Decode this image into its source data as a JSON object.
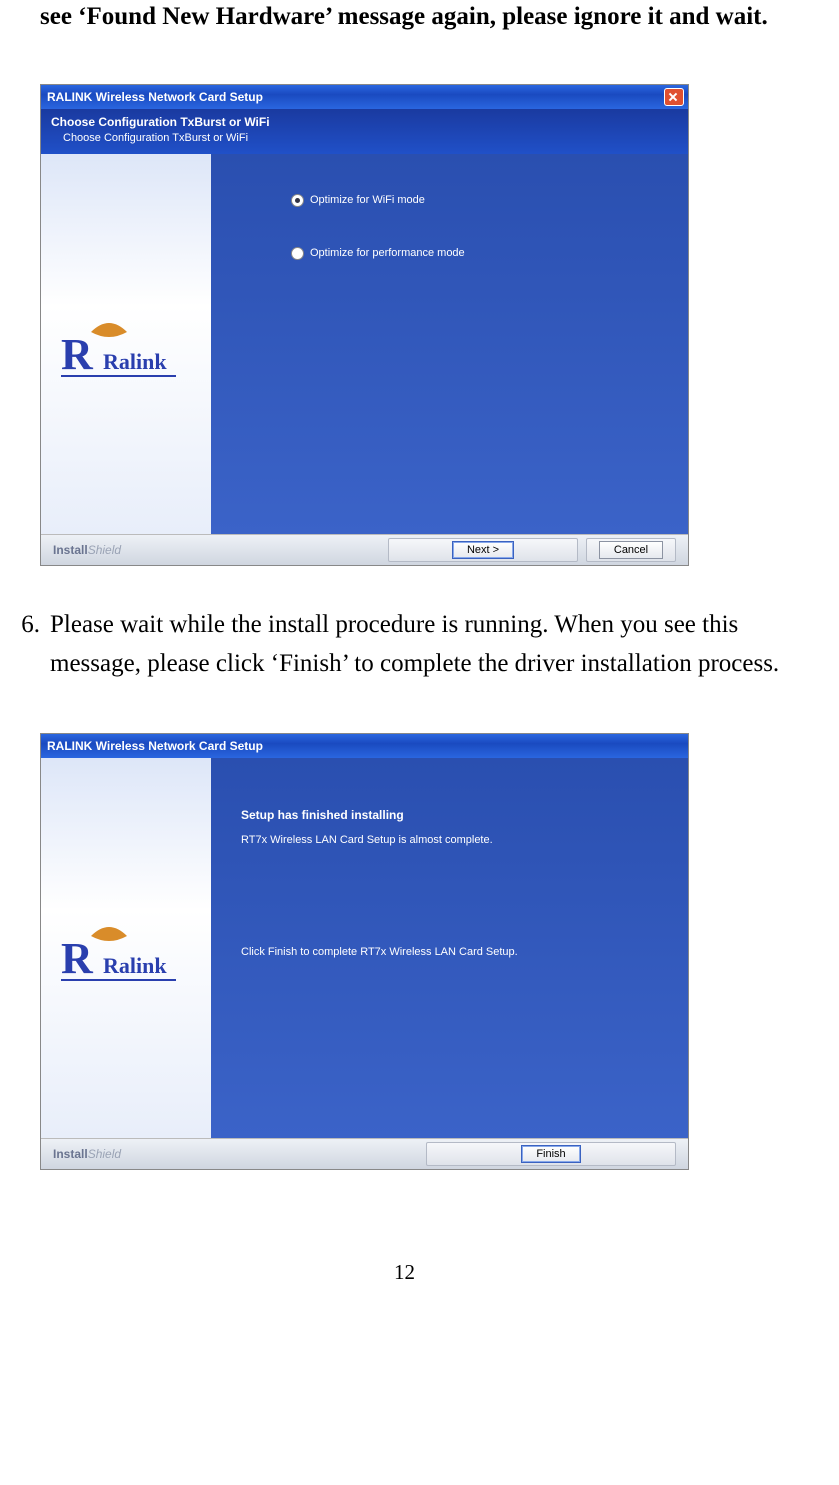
{
  "intro_text": "see ‘Found New Hardware’ message again, please ignore it and wait.",
  "step6": {
    "num": "6.",
    "text": "Please wait while the install procedure is running. When you see this message, please click ‘Finish’ to complete the driver installation process."
  },
  "dialog1": {
    "title": "RALINK Wireless Network Card Setup",
    "banner_heading": "Choose Configuration TxBurst or WiFi",
    "banner_sub": "Choose Configuration TxBurst or WiFi",
    "opt1": "Optimize for WiFi mode",
    "opt2": "Optimize for performance mode",
    "install_brand": "Install",
    "install_suffix": "Shield",
    "next": "Next >",
    "cancel": "Cancel"
  },
  "dialog2": {
    "title": "RALINK Wireless Network Card Setup",
    "heading": "Setup has finished installing",
    "msg1": "RT7x Wireless LAN Card Setup is almost complete.",
    "msg2": "Click Finish to complete RT7x Wireless LAN Card Setup.",
    "install_brand": "Install",
    "install_suffix": "Shield",
    "finish": "Finish"
  },
  "page_number": "12"
}
